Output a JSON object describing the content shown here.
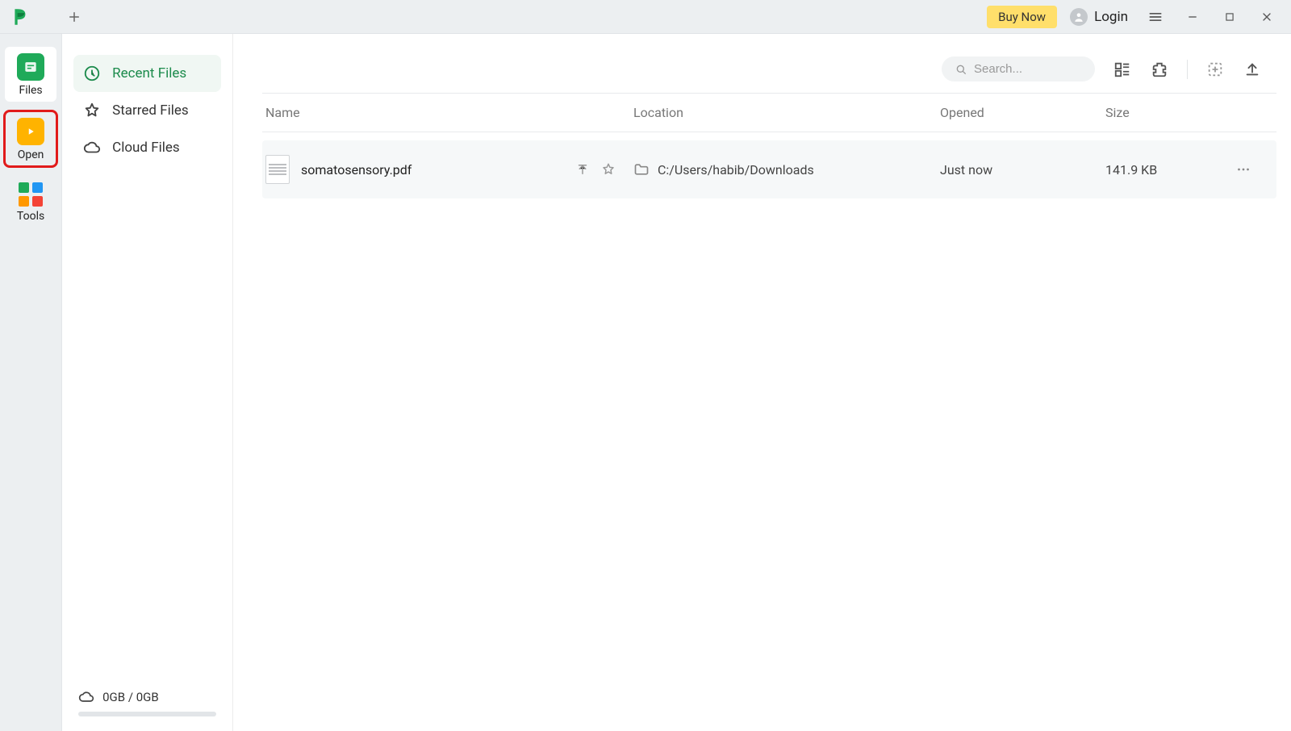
{
  "header": {
    "buy_now": "Buy Now",
    "login": "Login"
  },
  "rail": {
    "items": [
      {
        "label": "Files"
      },
      {
        "label": "Open"
      },
      {
        "label": "Tools"
      }
    ]
  },
  "sidebar": {
    "items": [
      {
        "label": "Recent Files"
      },
      {
        "label": "Starred Files"
      },
      {
        "label": "Cloud Files"
      }
    ]
  },
  "storage": {
    "text": "0GB / 0GB"
  },
  "search": {
    "placeholder": "Search..."
  },
  "table": {
    "headers": {
      "name": "Name",
      "location": "Location",
      "opened": "Opened",
      "size": "Size"
    },
    "rows": [
      {
        "name": "somatosensory.pdf",
        "location": "C:/Users/habib/Downloads",
        "opened": "Just now",
        "size": "141.9 KB"
      }
    ]
  }
}
